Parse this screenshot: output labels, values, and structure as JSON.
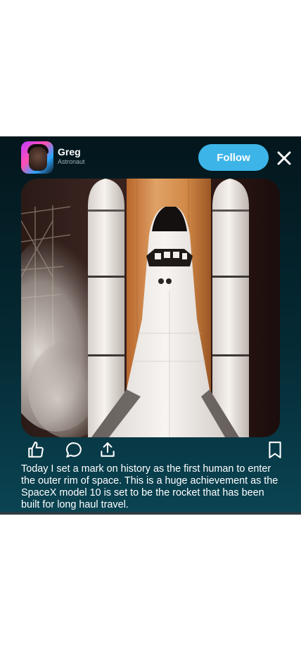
{
  "post": {
    "author": {
      "name": "Greg",
      "title": "Astronaut"
    },
    "follow_label": "Follow",
    "caption": "Today I set a mark on history as the first human to enter the outer rim of space. This is a huge achievement as the SpaceX model 10 is set to be the rocket that has been built for long haul travel."
  },
  "icons": {
    "close": "close-icon",
    "like": "thumbs-up-icon",
    "comment": "comment-icon",
    "share": "share-icon",
    "bookmark": "bookmark-icon"
  },
  "colors": {
    "card_background": "#052a34",
    "follow_button": "#3cb4e8",
    "text": "#ffffff",
    "subtitle": "#9bb3bb"
  }
}
